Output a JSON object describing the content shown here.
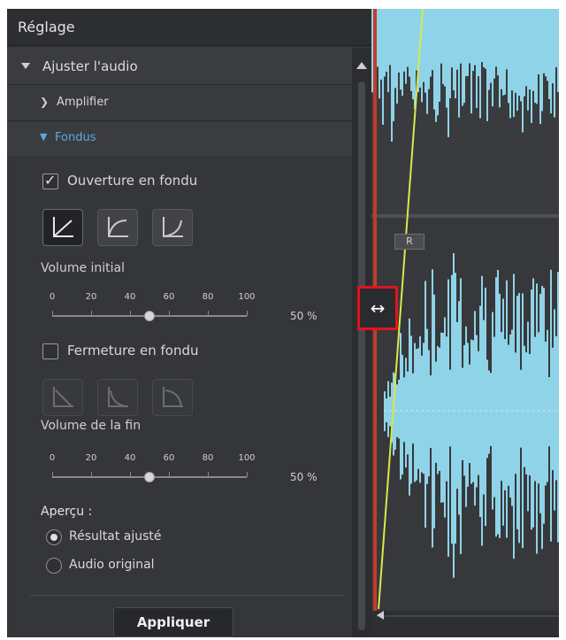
{
  "panel": {
    "title": "Réglage",
    "section_title": "Ajuster l'audio",
    "subsections": {
      "amplify": "Amplifier",
      "fades": "Fondus"
    }
  },
  "fade_in": {
    "checkbox_label": "Ouverture en fondu",
    "checked": true,
    "check_mark": "✓",
    "curve_presets": [
      {
        "name": "curve-linear-icon",
        "selected": true
      },
      {
        "name": "curve-log-icon",
        "selected": false
      },
      {
        "name": "curve-exp-icon",
        "selected": false
      }
    ],
    "volume_label": "Volume initial",
    "ticks": [
      "0",
      "20",
      "40",
      "60",
      "80",
      "100"
    ],
    "value_percent": 50,
    "value_text": "50 %"
  },
  "fade_out": {
    "checkbox_label": "Fermeture en fondu",
    "checked": false,
    "curve_presets": [
      {
        "name": "curve-linear-down-icon",
        "enabled": false
      },
      {
        "name": "curve-log-down-icon",
        "enabled": false
      },
      {
        "name": "curve-exp-down-icon",
        "enabled": false
      }
    ],
    "volume_label": "Volume de la fin",
    "ticks": [
      "0",
      "20",
      "40",
      "60",
      "80",
      "100"
    ],
    "value_percent": 50,
    "value_text": "50 %"
  },
  "preview": {
    "label": "Aperçu :",
    "options": [
      "Résultat ajusté",
      "Audio original"
    ],
    "selected": "Résultat ajusté"
  },
  "apply_button": "Appliquer",
  "waveform": {
    "channel_label": "R",
    "color": "#8fd3e8",
    "fade_line_color": "#d8e84a",
    "playhead_color": "#c23b2a"
  },
  "cursor": {
    "icon": "resize-horizontal-icon",
    "glyph": "↔",
    "highlight_color": "#e0141e"
  }
}
